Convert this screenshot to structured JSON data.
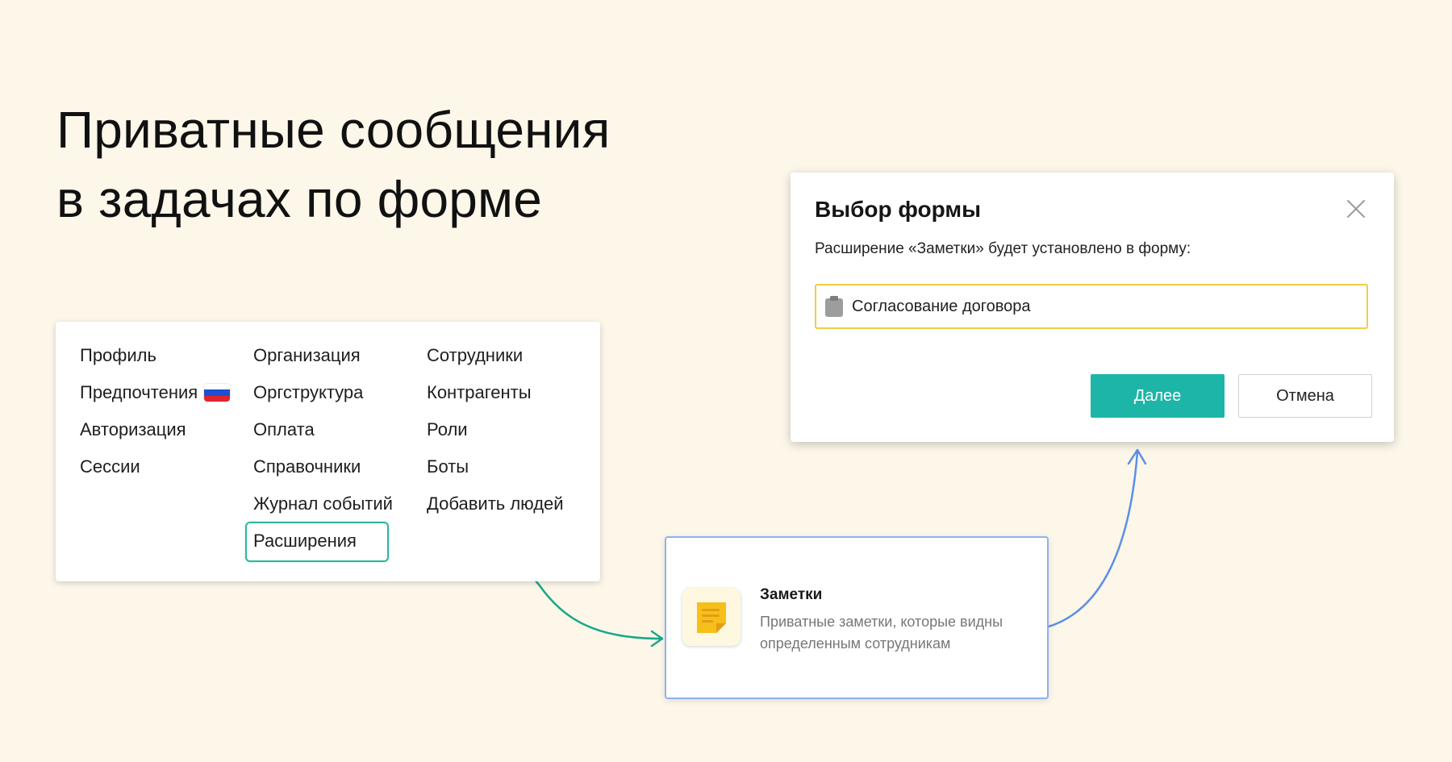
{
  "headline": {
    "line1": "Приватные сообщения",
    "line2": "в задачах по форме"
  },
  "menu": {
    "col1": [
      "Профиль",
      "Предпочтения",
      "Авторизация",
      "Сессии"
    ],
    "col2": [
      "Организация",
      "Оргструктура",
      "Оплата",
      "Справочники",
      "Журнал событий",
      "Расширения"
    ],
    "col3": [
      "Сотрудники",
      "Контрагенты",
      "Роли",
      "Боты",
      "Добавить людей"
    ],
    "active_item": "Расширения",
    "flag_icon": "russian-flag-icon"
  },
  "extension": {
    "title": "Заметки",
    "description": "Приватные заметки, которые видны определенным сотрудникам",
    "icon": "sticky-note-icon"
  },
  "dialog": {
    "title": "Выбор формы",
    "text": "Расширение «Заметки» будет установлено в форму:",
    "selected_form": "Согласование договора",
    "next_label": "Далее",
    "cancel_label": "Отмена"
  },
  "colors": {
    "background": "#fdf7ea",
    "accent_teal": "#1db5a7",
    "arrow_green": "#19a886",
    "arrow_blue": "#5b8fe8",
    "select_border": "#f2cc45"
  }
}
